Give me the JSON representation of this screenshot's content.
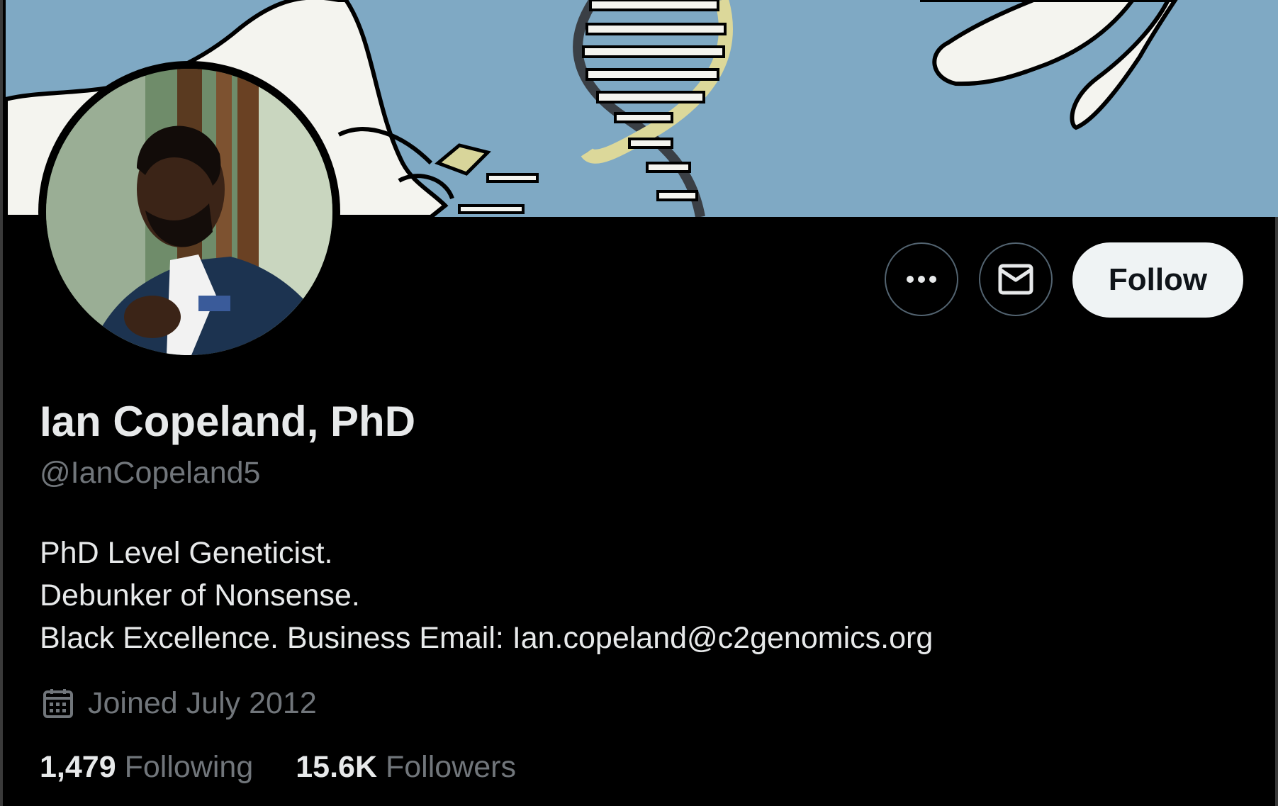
{
  "profile": {
    "display_name": "Ian Copeland, PhD",
    "handle": "@IanCopeland5",
    "bio_lines": [
      "PhD Level Geneticist.",
      "Debunker of Nonsense.",
      "Black Excellence. Business Email: Ian.copeland@c2genomics.org"
    ],
    "joined": "Joined July 2012",
    "following_count": "1,479",
    "following_label": "Following",
    "followers_count": "15.6K",
    "followers_label": "Followers"
  },
  "actions": {
    "more_icon": "more-dots-icon",
    "message_icon": "envelope-icon",
    "follow_label": "Follow"
  },
  "icons": {
    "joined": "calendar-icon"
  },
  "colors": {
    "background": "#000000",
    "primary_text": "#e7e9ea",
    "secondary_text": "#71767b",
    "button_border": "#536471",
    "follow_bg": "#eff3f4",
    "follow_text": "#0f1419",
    "banner_sky": "#7fa9c4"
  }
}
